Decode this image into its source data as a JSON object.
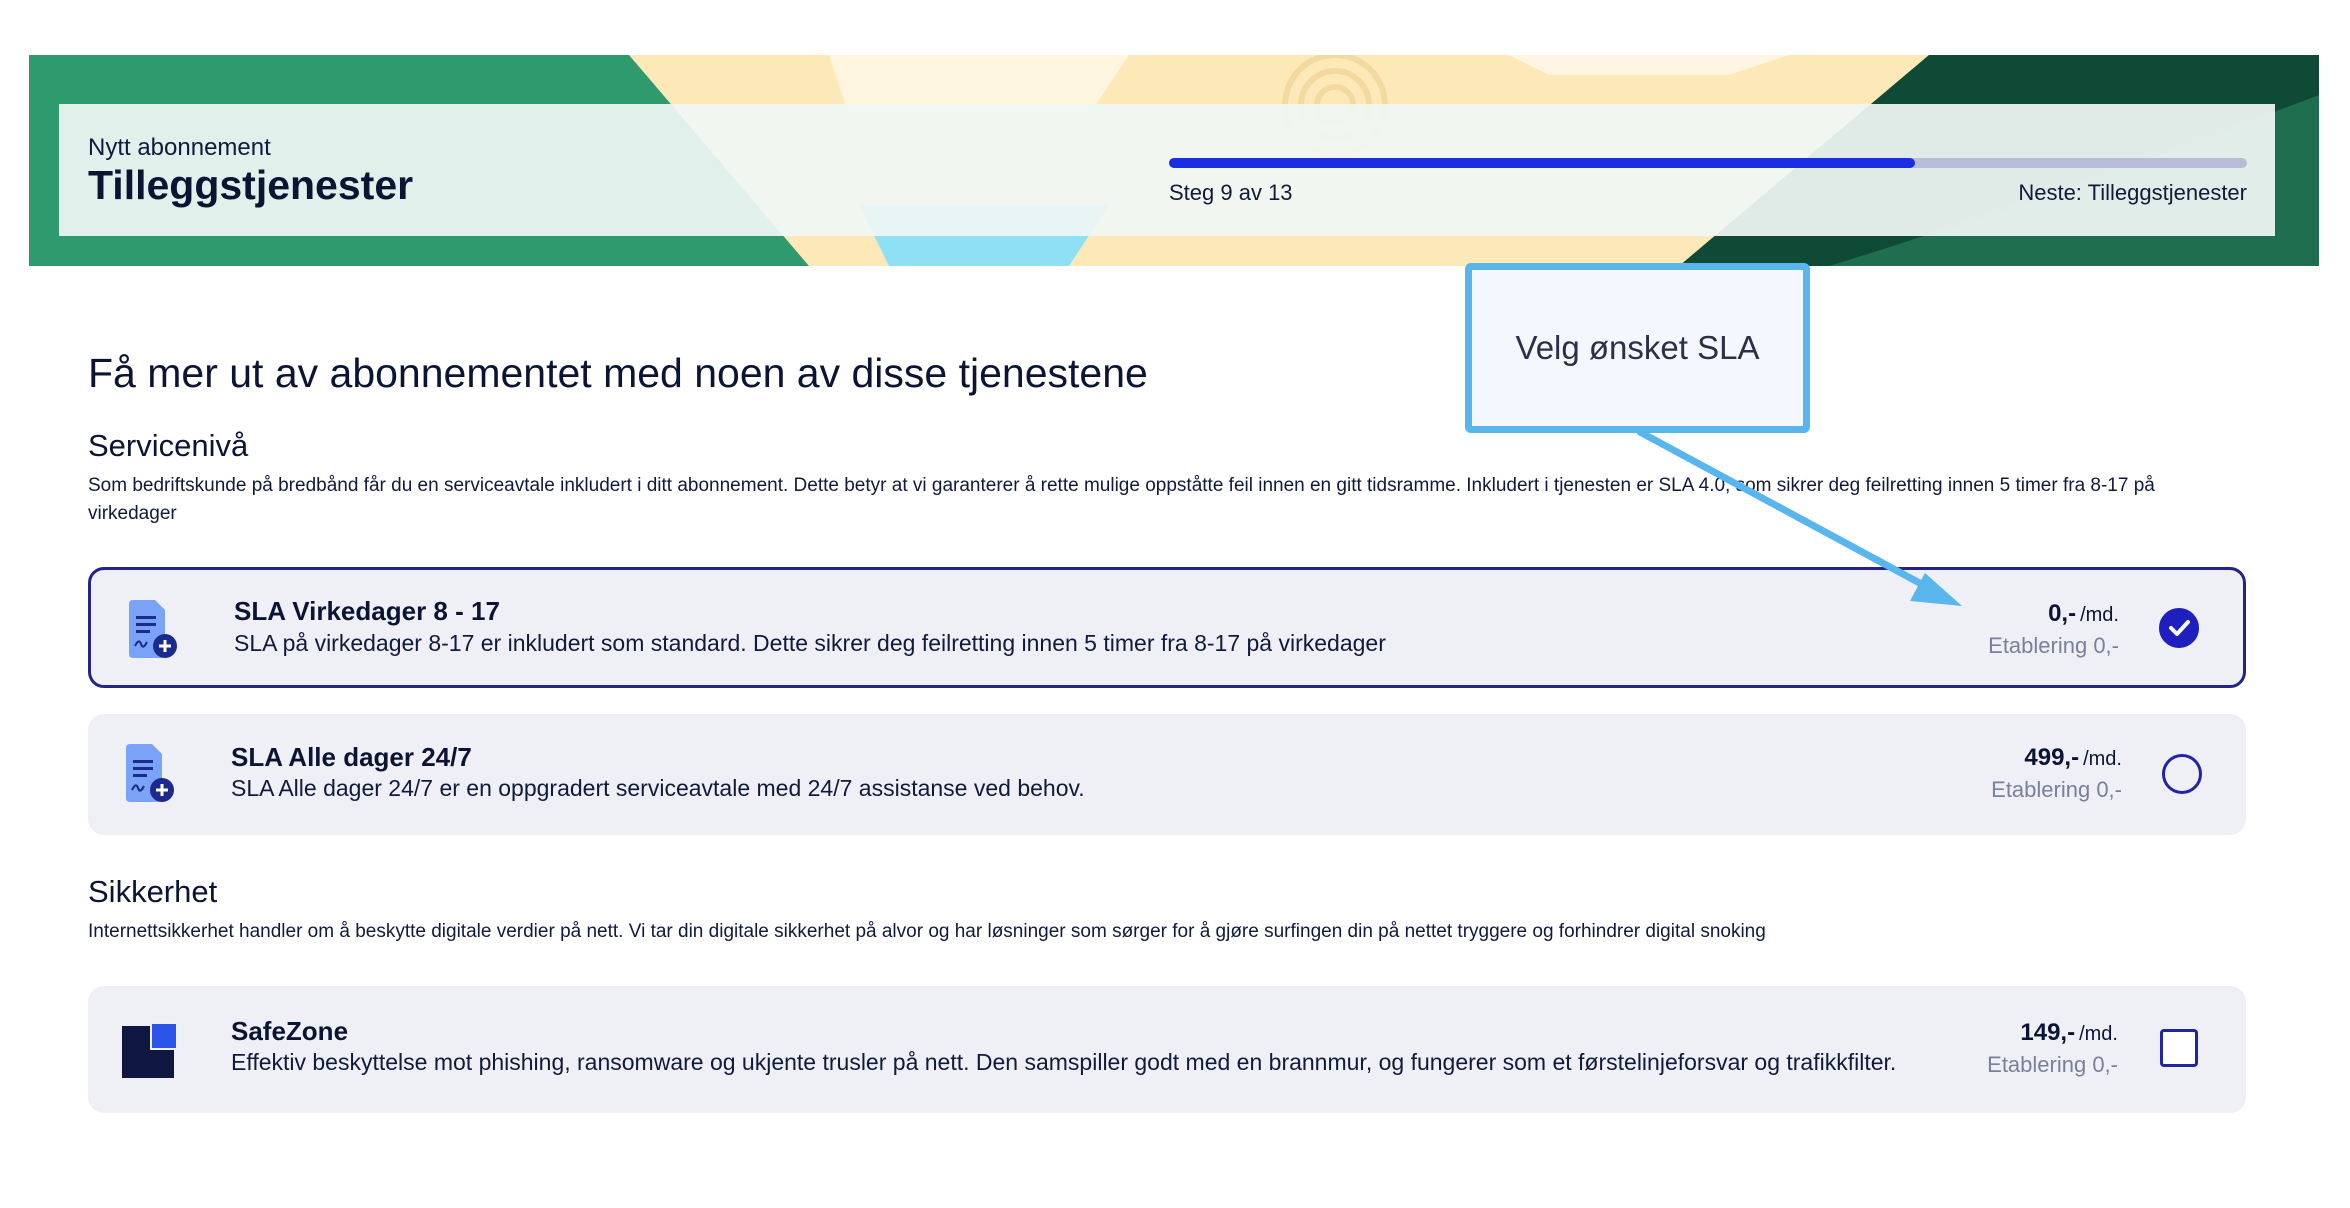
{
  "header": {
    "eyebrow": "Nytt abonnement",
    "title": "Tilleggstjenester",
    "step_label": "Steg 9 av 13",
    "next_label": "Neste: Tilleggstjenester",
    "progress_fraction": 0.692
  },
  "main_heading": "Få mer ut av abonnementet med noen av disse tjenestene",
  "service_level": {
    "title": "Servicenivå",
    "description": "Som bedriftskunde på bredbånd får du en serviceavtale inkludert i ditt abonnement. Dette betyr at vi garanterer å rette mulige oppståtte feil innen en gitt tidsramme. Inkludert i tjenesten er SLA 4.0, som sikrer deg feilretting innen 5 timer fra 8-17 på virkedager",
    "options": [
      {
        "title": "SLA Virkedager 8 - 17",
        "description": "SLA på virkedager 8-17 er inkludert som standard. Dette sikrer deg feilretting innen 5 timer fra 8-17 på virkedager",
        "price": "0,-",
        "unit": "/md.",
        "setup": "Etablering 0,-",
        "selected": true
      },
      {
        "title": "SLA Alle dager 24/7",
        "description": "SLA Alle dager 24/7 er en oppgradert serviceavtale med 24/7 assistanse ved behov.",
        "price": "499,-",
        "unit": "/md.",
        "setup": "Etablering 0,-",
        "selected": false
      }
    ]
  },
  "security": {
    "title": "Sikkerhet",
    "description": "Internettsikkerhet handler om å beskytte digitale verdier på nett. Vi tar din digitale sikkerhet på alvor og har løsninger som sørger for å gjøre surfingen din på nettet tryggere og forhindrer digital snoking",
    "options": [
      {
        "title": "SafeZone",
        "description": "Effektiv beskyttelse mot phishing, ransomware og ukjente trusler på nett. Den samspiller godt med en brannmur, og fungerer som et førstelinjeforsvar og trafikkfilter.",
        "price": "149,-",
        "unit": "/md.",
        "setup": "Etablering 0,-",
        "checked": false
      }
    ]
  },
  "callout": {
    "text": "Velg ønsket SLA"
  },
  "icons": {
    "sla_icon": "document-plus-icon",
    "safezone_icon": "safezone-logo-icon",
    "radio_checked": "checkmark-icon"
  },
  "colors": {
    "banner_green": "#2f9a6e",
    "progress_fill": "#1a2de0",
    "progress_track": "#b9bcd6",
    "selected_border": "#232389",
    "callout_border": "#58b6ec",
    "option_bg": "#eff0f5"
  }
}
